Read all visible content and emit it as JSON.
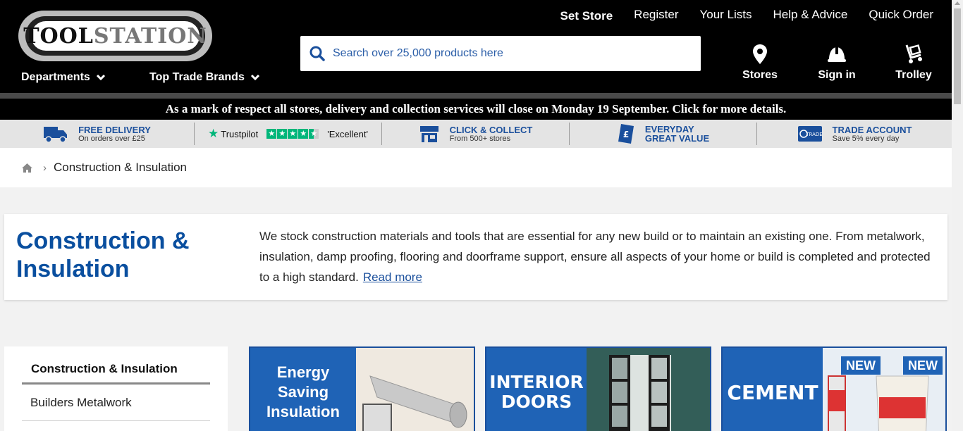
{
  "brand": {
    "logo_text_a": "TOOL",
    "logo_text_b": "STATION"
  },
  "top_links": {
    "set_store": "Set Store",
    "register": "Register",
    "your_lists": "Your Lists",
    "help": "Help & Advice",
    "quick_order": "Quick Order"
  },
  "search": {
    "placeholder": "Search over 25,000 products here"
  },
  "nav": {
    "departments": "Departments",
    "brands": "Top Trade Brands"
  },
  "header_icons": {
    "stores": "Stores",
    "sign_in": "Sign in",
    "trolley": "Trolley"
  },
  "notice": "As a mark of respect all stores, delivery and collection services will close on Monday 19 September. Click for more details.",
  "usp": {
    "delivery_title": "FREE DELIVERY",
    "delivery_sub": "On orders over £25",
    "trustpilot": "Trustpilot",
    "trustpilot_rating": "'Excellent'",
    "collect_title": "CLICK & COLLECT",
    "collect_sub": "From 500+ stores",
    "value_title_1": "EVERYDAY",
    "value_title_2": "GREAT VALUE",
    "trade_title": "TRADE ACCOUNT",
    "trade_sub": "Save 5% every day",
    "trade_badge": "TRADE"
  },
  "breadcrumb": {
    "current": "Construction & Insulation"
  },
  "intro": {
    "title": "Construction & Insulation",
    "body": "We stock construction materials and tools that are essential for any new build or to maintain an existing one. From metalwork, insulation, damp proofing, flooring and doorframe support, ensure all aspects of your home or build is completed and protected to a high standard.",
    "read_more": "Read more"
  },
  "sidebar": {
    "title": "Construction & Insulation",
    "item_1": "Builders Metalwork"
  },
  "cards": {
    "card1": "Energy Saving Insulation",
    "card2": "INTERIOR DOORS",
    "card3": "CEMENT",
    "new_badge": "NEW"
  },
  "colors": {
    "brand_blue": "#0a4f9f",
    "trustpilot_green": "#00b67a"
  }
}
